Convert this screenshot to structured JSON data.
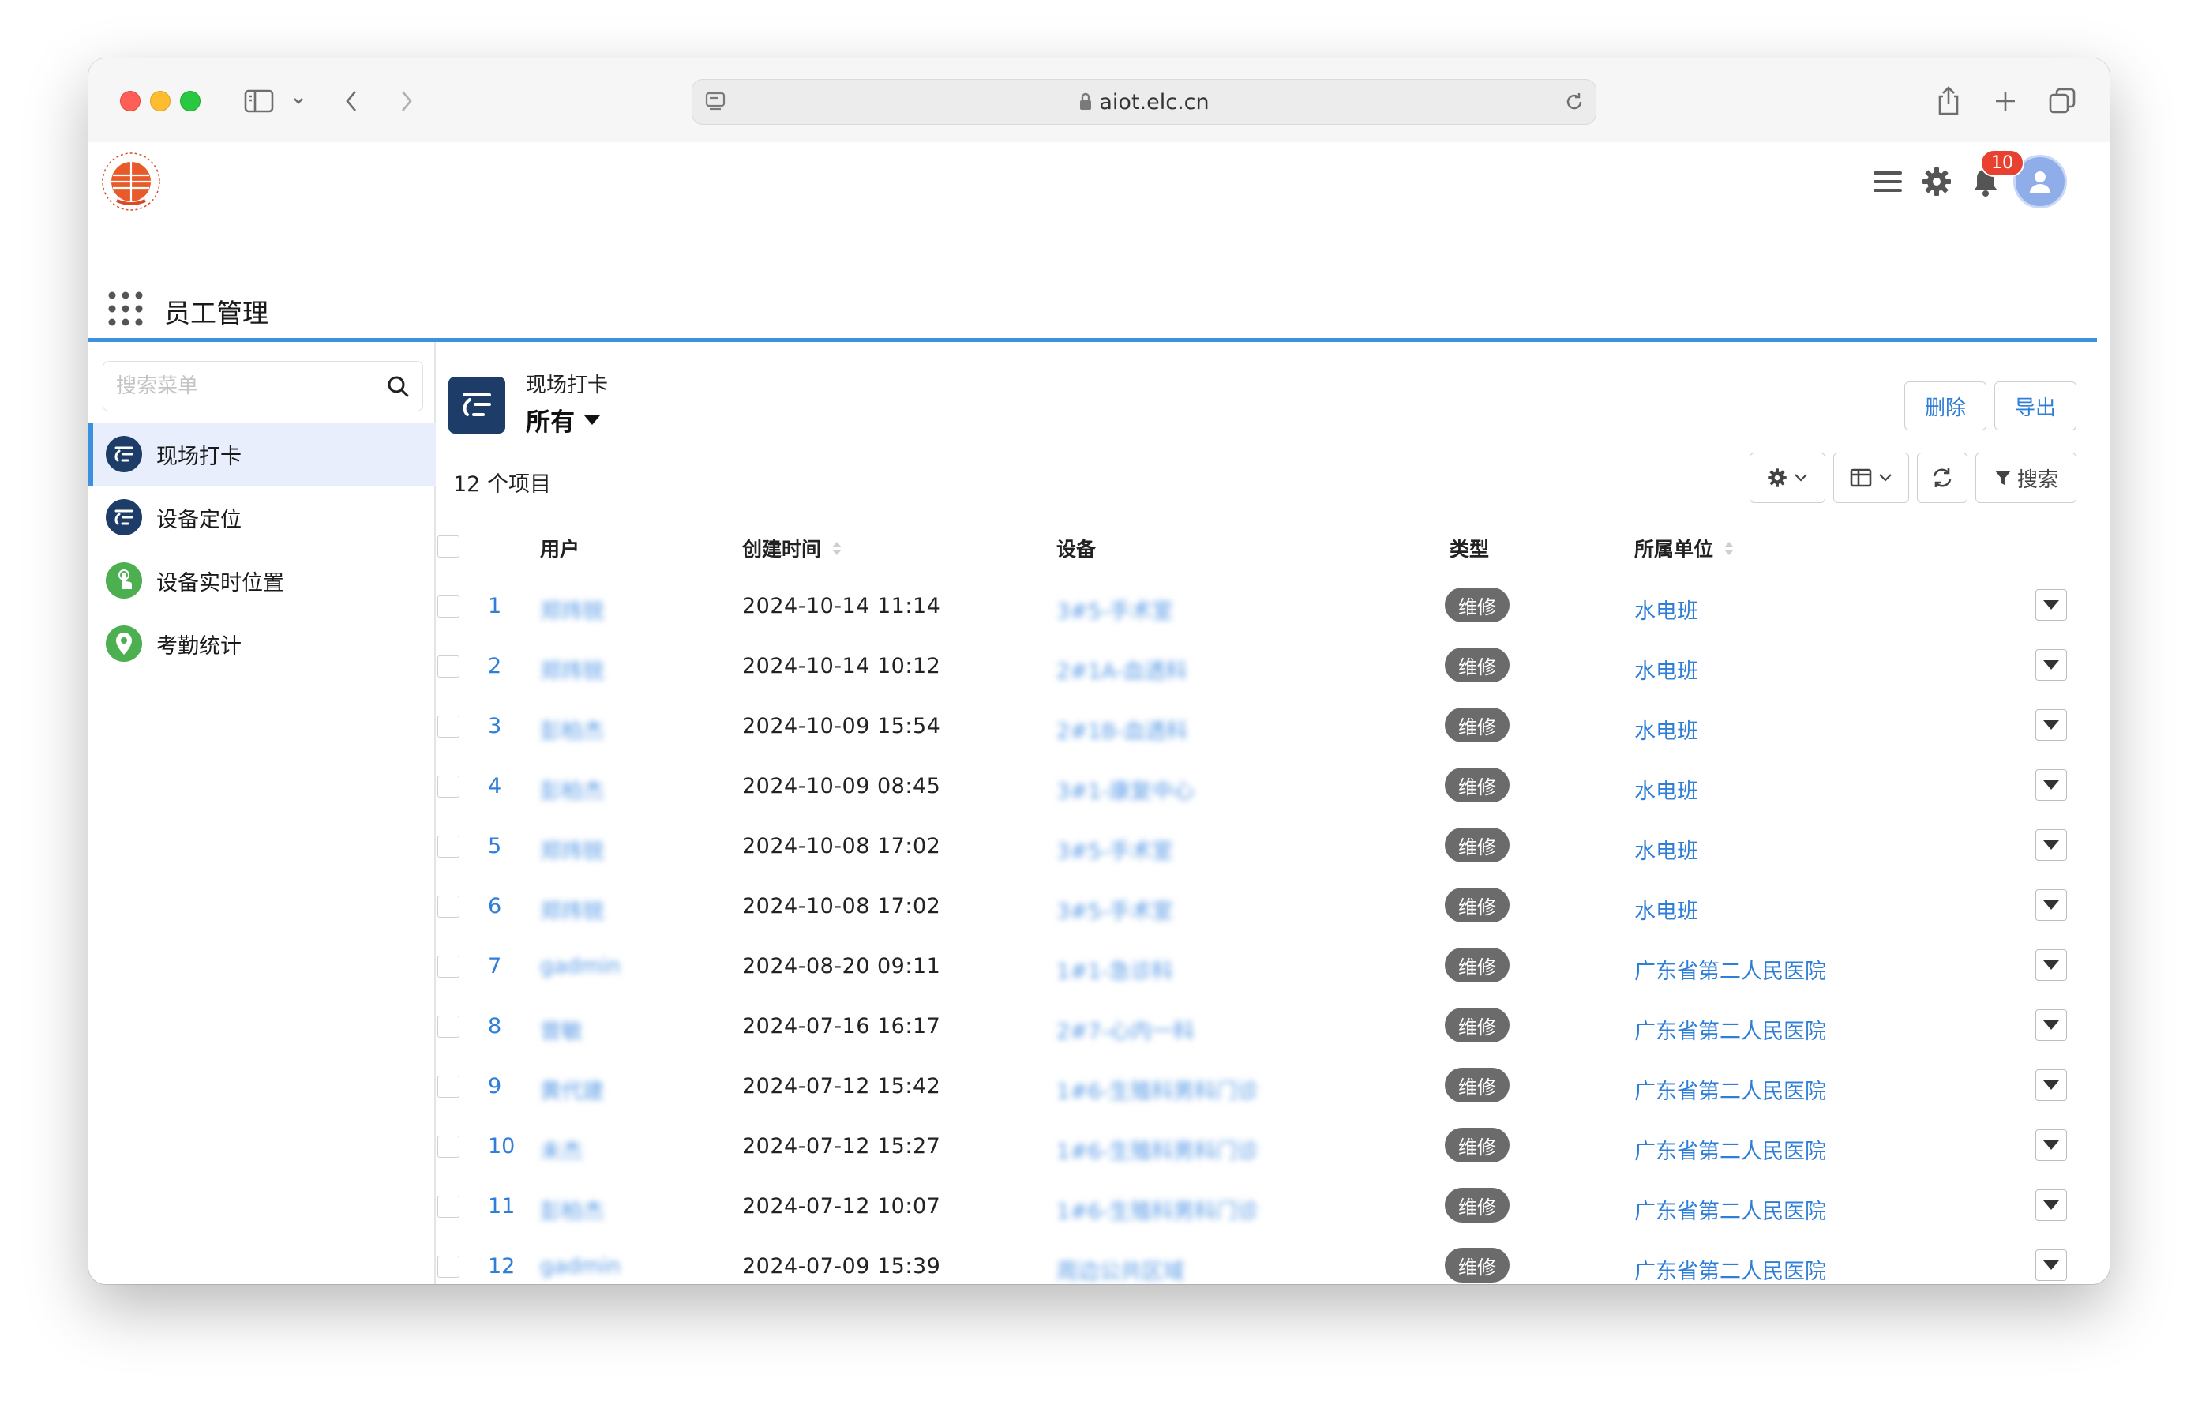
{
  "browser": {
    "url": "aiot.elc.cn"
  },
  "header": {
    "app_title": "员工管理",
    "notification_count": "10"
  },
  "sidebar": {
    "search_placeholder": "搜索菜单",
    "items": [
      {
        "label": "现场打卡",
        "icon": "clock-in-icon",
        "color": "#1d3d68",
        "active": true
      },
      {
        "label": "设备定位",
        "icon": "clock-in-icon",
        "color": "#1d3d68",
        "active": false
      },
      {
        "label": "设备实时位置",
        "icon": "touch-icon",
        "color": "#4caf50",
        "active": false
      },
      {
        "label": "考勤统计",
        "icon": "location-pin-icon",
        "color": "#4caf50",
        "active": false
      }
    ]
  },
  "page": {
    "title": "现场打卡",
    "view": "所有",
    "count_text": "12 个项目",
    "buttons": {
      "delete": "删除",
      "export": "导出",
      "search": "搜索"
    }
  },
  "table": {
    "columns": {
      "user": "用户",
      "created": "创建时间",
      "device": "设备",
      "type": "类型",
      "unit": "所属单位"
    },
    "rows": [
      {
        "index": "1",
        "user": "郑炜锐",
        "created": "2024-10-14 11:14",
        "device": "3#5-手术室",
        "type": "维修",
        "unit": "水电班"
      },
      {
        "index": "2",
        "user": "郑炜锐",
        "created": "2024-10-14 10:12",
        "device": "2#1A-血透科",
        "type": "维修",
        "unit": "水电班"
      },
      {
        "index": "3",
        "user": "彭柏杰",
        "created": "2024-10-09 15:54",
        "device": "2#1B-血透科",
        "type": "维修",
        "unit": "水电班"
      },
      {
        "index": "4",
        "user": "彭柏杰",
        "created": "2024-10-09 08:45",
        "device": "3#1-康复中心",
        "type": "维修",
        "unit": "水电班"
      },
      {
        "index": "5",
        "user": "郑炜锐",
        "created": "2024-10-08 17:02",
        "device": "3#5-手术室",
        "type": "维修",
        "unit": "水电班"
      },
      {
        "index": "6",
        "user": "郑炜锐",
        "created": "2024-10-08 17:02",
        "device": "3#5-手术室",
        "type": "维修",
        "unit": "水电班"
      },
      {
        "index": "7",
        "user": "gadmin",
        "created": "2024-08-20 09:11",
        "device": "1#1-急诊科",
        "type": "维修",
        "unit": "广东省第二人民医院"
      },
      {
        "index": "8",
        "user": "曾敏",
        "created": "2024-07-16 16:17",
        "device": "2#7-心内一科",
        "type": "维修",
        "unit": "广东省第二人民医院"
      },
      {
        "index": "9",
        "user": "黄代建",
        "created": "2024-07-12 15:42",
        "device": "1#6-生殖科男科门诊",
        "type": "维修",
        "unit": "广东省第二人民医院"
      },
      {
        "index": "10",
        "user": "未杰",
        "created": "2024-07-12 15:27",
        "device": "1#6-生殖科男科门诊",
        "type": "维修",
        "unit": "广东省第二人民医院"
      },
      {
        "index": "11",
        "user": "彭柏杰",
        "created": "2024-07-12 10:07",
        "device": "1#6-生殖科男科门诊",
        "type": "维修",
        "unit": "广东省第二人民医院"
      },
      {
        "index": "12",
        "user": "gadmin",
        "created": "2024-07-09 15:39",
        "device": "周边公共区域",
        "type": "维修",
        "unit": "广东省第二人民医院"
      }
    ]
  }
}
